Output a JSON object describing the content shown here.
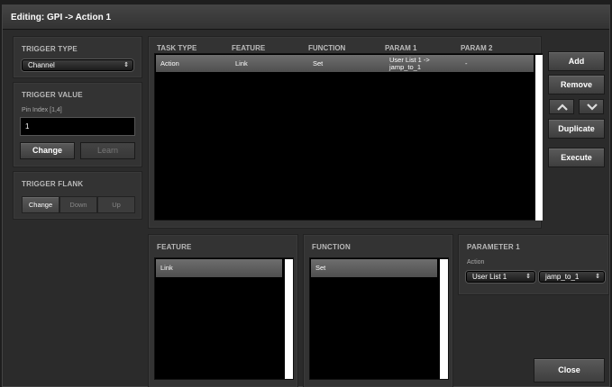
{
  "window": {
    "title": "Editing: GPI -> Action 1"
  },
  "trigger_type": {
    "heading": "TRIGGER TYPE",
    "selected": "Channel"
  },
  "trigger_value": {
    "heading": "TRIGGER VALUE",
    "field_label": "Pin Index [1,4]",
    "value": "1",
    "change_label": "Change",
    "learn_label": "Learn"
  },
  "trigger_flank": {
    "heading": "TRIGGER FLANK",
    "options": [
      "Change",
      "Down",
      "Up"
    ],
    "selected": "Change"
  },
  "task_table": {
    "columns": [
      "TASK TYPE",
      "FEATURE",
      "FUNCTION",
      "PARAM 1",
      "PARAM 2"
    ],
    "rows": [
      {
        "task_type": "Action",
        "feature": "Link",
        "function": "Set",
        "param1": "User List 1 -> jamp_to_1",
        "param2": "-"
      }
    ]
  },
  "actions": {
    "add": "Add",
    "remove": "Remove",
    "duplicate": "Duplicate",
    "execute": "Execute",
    "close": "Close"
  },
  "feature_panel": {
    "heading": "FEATURE",
    "items": [
      "Link"
    ]
  },
  "function_panel": {
    "heading": "FUNCTION",
    "items": [
      "Set"
    ]
  },
  "parameter_panel": {
    "heading": "PARAMETER 1",
    "field_label": "Action",
    "list_selected": "User List 1",
    "target_selected": "jamp_to_1"
  },
  "icons": {
    "move_up": "chevron-up-icon",
    "move_down": "chevron-down-icon",
    "select_arrows": "updown-arrows-icon"
  },
  "colors": {
    "background": "#2b2b2b",
    "panel": "#333333",
    "grid": "#000000",
    "selected_row": "#5f5f5f"
  }
}
